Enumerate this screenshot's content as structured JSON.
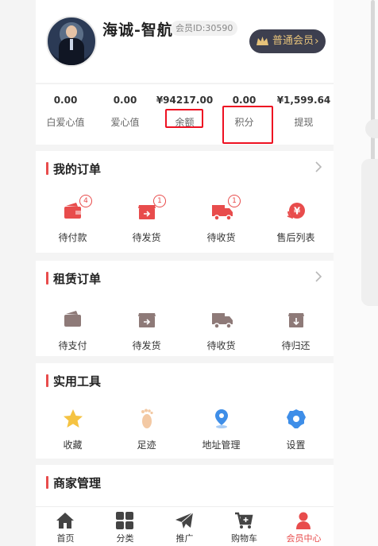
{
  "profile": {
    "name": "海诚-智航",
    "member_id": "会员ID:30590",
    "vip_label": "普通会员",
    "vip_chevron": "›"
  },
  "stats": [
    {
      "value": "0.00",
      "label": "白爱心值"
    },
    {
      "value": "0.00",
      "label": "爱心值"
    },
    {
      "value": "¥94217.00",
      "label": "余额",
      "highlighted": true
    },
    {
      "value": "0.00",
      "label": "积分",
      "highlighted": true
    },
    {
      "value": "¥1,599.64",
      "label": "提现"
    }
  ],
  "my_orders": {
    "title": "我的订单",
    "items": [
      {
        "label": "待付款",
        "icon": "wallet-icon",
        "badge": "4"
      },
      {
        "label": "待发货",
        "icon": "box-icon",
        "badge": "1"
      },
      {
        "label": "待收货",
        "icon": "truck-icon",
        "badge": "1"
      },
      {
        "label": "售后列表",
        "icon": "refund-icon"
      }
    ]
  },
  "rental_orders": {
    "title": "租赁订单",
    "items": [
      {
        "label": "待支付",
        "icon": "wallet-icon"
      },
      {
        "label": "待发货",
        "icon": "box-icon"
      },
      {
        "label": "待收货",
        "icon": "truck-icon"
      },
      {
        "label": "待归还",
        "icon": "return-box-icon"
      }
    ]
  },
  "tools": {
    "title": "实用工具",
    "items": [
      {
        "label": "收藏",
        "icon": "star-icon"
      },
      {
        "label": "足迹",
        "icon": "footprint-icon"
      },
      {
        "label": "地址管理",
        "icon": "location-pin-icon"
      },
      {
        "label": "设置",
        "icon": "gear-icon"
      }
    ]
  },
  "merchant": {
    "title": "商家管理"
  },
  "tabbar": [
    {
      "label": "首页",
      "icon": "home-icon"
    },
    {
      "label": "分类",
      "icon": "grid-icon"
    },
    {
      "label": "推广",
      "icon": "paper-plane-icon"
    },
    {
      "label": "购物车",
      "icon": "cart-icon"
    },
    {
      "label": "会员中心",
      "icon": "user-icon",
      "active": true
    }
  ],
  "colors": {
    "accent": "#e84c4c",
    "order_icon": "#e84c4c",
    "rental_icon": "#8e7a78",
    "star": "#f5c342",
    "footprint": "#f3c9a4",
    "location": "#3e8ee8",
    "gear": "#3e8ee8",
    "highlight_box": "#ee1122",
    "vip_bg": "#3d3f4f",
    "vip_text": "#e6c27a"
  }
}
